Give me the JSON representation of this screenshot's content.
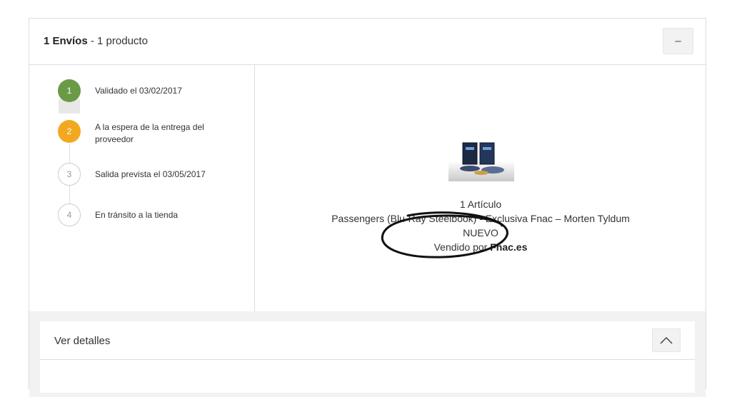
{
  "shipment": {
    "title_bold": "1 Envíos",
    "title_rest": " - 1 producto",
    "collapse_label": "–"
  },
  "steps": [
    {
      "number": "1",
      "label": "Validado el 03/02/2017",
      "status": "completed"
    },
    {
      "number": "2",
      "label": "A la espera de la entrega del proveedor",
      "status": "current"
    },
    {
      "number": "3",
      "label": "Salida prevista el 03/05/2017",
      "status": "pending"
    },
    {
      "number": "4",
      "label": "En tránsito a la tienda",
      "status": "pending"
    }
  ],
  "product": {
    "quantity": "1 Artículo",
    "name": "Passengers (Blu-Ray Steelbook) - Exclusiva Fnac – Morten Tyldum",
    "condition": "NUEVO",
    "sold_by_prefix": "Vendido por ",
    "seller": "Fnac.es"
  },
  "details": {
    "title": "Ver detalles"
  },
  "colors": {
    "step_completed": "#6a9a45",
    "step_current": "#f2a91f",
    "step_pending": "#ffffff"
  }
}
